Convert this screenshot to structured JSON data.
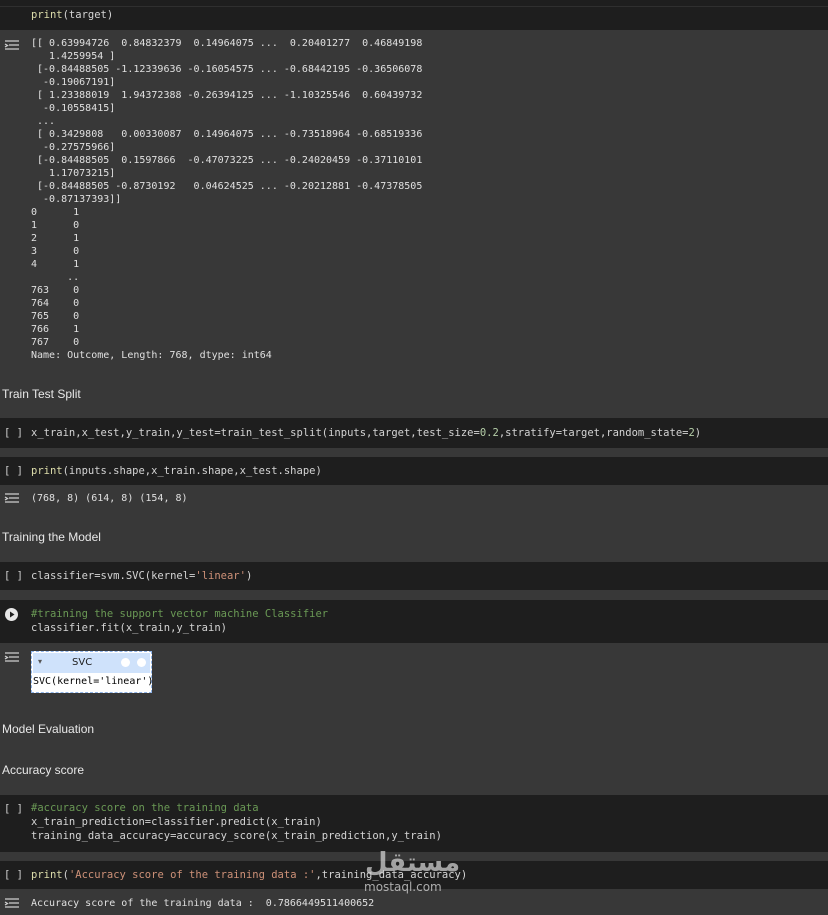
{
  "cells": {
    "top": {
      "code": "print(target)"
    },
    "split": {
      "indicator": "[ ]",
      "code": "x_train,x_test,y_train,y_test=train_test_split(inputs,target,test_size=0.2,stratify=target,random_state=2)"
    },
    "shape": {
      "indicator": "[ ]",
      "code": "print(inputs.shape,x_train.shape,x_test.shape)",
      "output": "(768, 8) (614, 8) (154, 8)"
    },
    "svc": {
      "indicator": "[ ]",
      "code": "classifier=svm.SVC(kernel='linear')"
    },
    "fit": {
      "comment": "#training the support vector machine Classifier",
      "code": "classifier.fit(x_train,y_train)"
    },
    "acc_train": {
      "indicator": "[ ]",
      "comment": "#accuracy score on the training data",
      "line2": "x_train_prediction=classifier.predict(x_train)",
      "line3": "training_data_accuracy=accuracy_score(x_train_prediction,y_train)"
    },
    "acc_print": {
      "indicator": "[ ]",
      "code": "print('Accuracy score of the training data :',training_data_accuracy)",
      "output": "Accuracy score of the training data :  0.7866449511400652"
    }
  },
  "target_output": [
    "[[ 0.63994726  0.84832379  0.14964075 ...  0.20401277  0.46849198",
    "   1.4259954 ]",
    " [-0.84488505 -1.12339636 -0.16054575 ... -0.68442195 -0.36506078",
    "  -0.19067191]",
    " [ 1.23388019  1.94372388 -0.26394125 ... -1.10325546  0.60439732",
    "  -0.10558415]",
    " ...",
    " [ 0.3429808   0.00330087  0.14964075 ... -0.73518964 -0.68519336",
    "  -0.27575966]",
    " [-0.84488505  0.1597866  -0.47073225 ... -0.24020459 -0.37110101",
    "   1.17073215]",
    " [-0.84488505 -0.8730192   0.04624525 ... -0.20212881 -0.47378505",
    "  -0.87137393]]",
    "0      1",
    "1      0",
    "2      1",
    "3      0",
    "4      1",
    "      ..",
    "763    0",
    "764    0",
    "765    0",
    "766    1",
    "767    0",
    "Name: Outcome, Length: 768, dtype: int64"
  ],
  "markdown": {
    "train_test_split": "Train Test Split",
    "training_model": "Training the Model",
    "model_evaluation": "Model Evaluation",
    "accuracy_score": "Accuracy score"
  },
  "svc_widget": {
    "title": "SVC",
    "repr": "SVC(kernel='linear')",
    "arrow": "▾"
  },
  "watermark": {
    "arabic": "مستقل",
    "latin": "mostaql.com"
  },
  "colors": {
    "cell_bg": "#1e1e1e",
    "page_bg": "#383838",
    "string": "#ce9178",
    "number": "#b5cea8",
    "comment": "#6a9955",
    "function": "#dcdcaa"
  }
}
